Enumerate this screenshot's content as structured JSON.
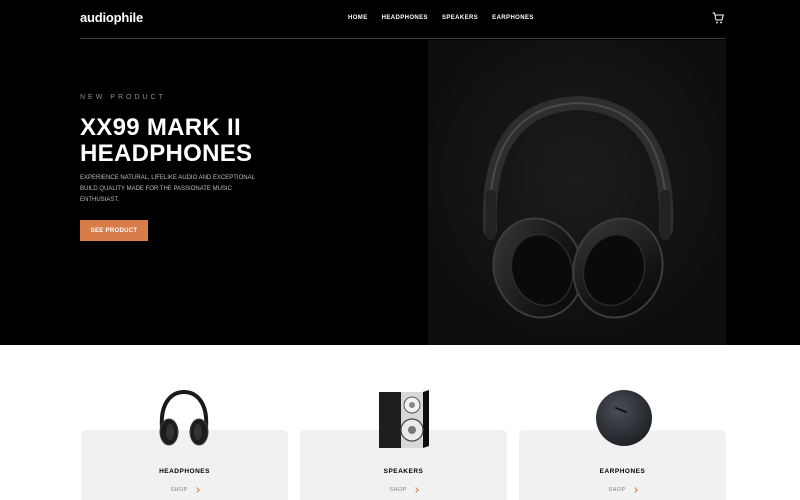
{
  "brand": {
    "logo": "audiophile"
  },
  "nav": {
    "links": [
      "HOME",
      "HEADPHONES",
      "SPEAKERS",
      "EARPHONES"
    ],
    "cart_icon": "cart-icon"
  },
  "hero": {
    "overline": "NEW PRODUCT",
    "title": "XX99 MARK II HEADPHONES",
    "description": "EXPERIENCE NATURAL, LIFELIKE AUDIO AND EXCEPTIONAL BUILD QUALITY MADE FOR THE PASSIONATE MUSIC ENTHUSIAST.",
    "cta_label": "SEE PRODUCT",
    "image_icon": "headphones-image"
  },
  "categories": [
    {
      "label": "HEADPHONES",
      "shop": "SHOP",
      "image_icon": "headphones-image"
    },
    {
      "label": "SPEAKERS",
      "shop": "SHOP",
      "image_icon": "speaker-image"
    },
    {
      "label": "EARPHONES",
      "shop": "SHOP",
      "image_icon": "earphones-case-image"
    }
  ],
  "colors": {
    "accent": "#d87d4a",
    "hero_bg": "#000000",
    "card_bg": "#f1f1f1"
  }
}
